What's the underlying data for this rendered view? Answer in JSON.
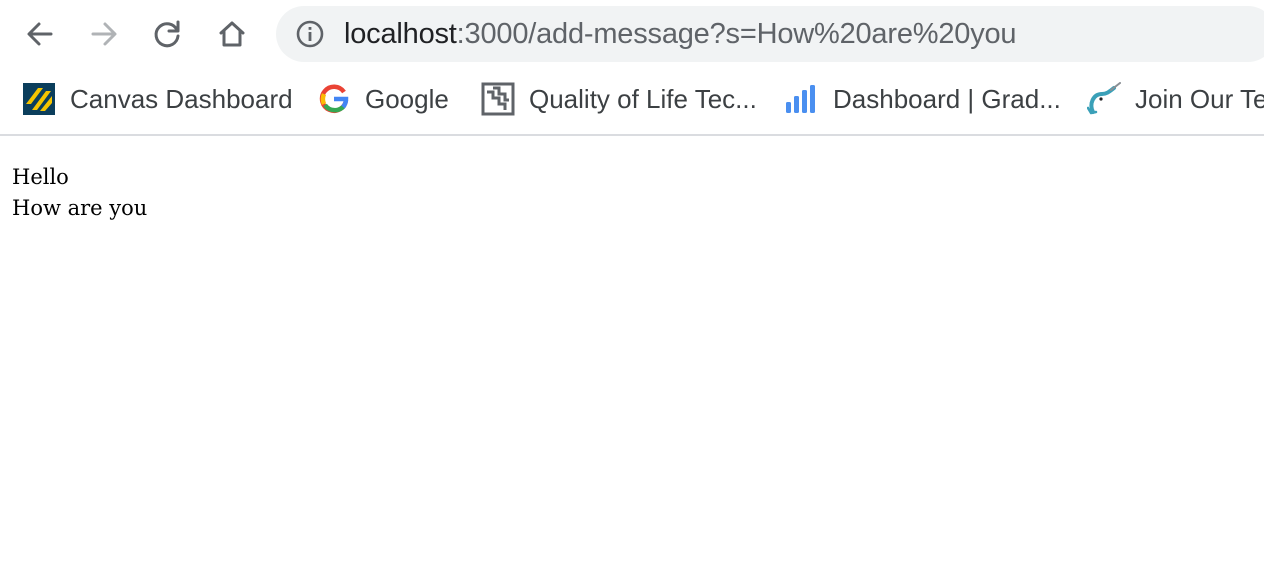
{
  "browser": {
    "nav": {
      "back": "arrow-left-icon",
      "forward": "arrow-right-icon",
      "reload": "reload-icon",
      "home": "home-icon"
    },
    "omnibox": {
      "host": "localhost",
      "rest": ":3000/add-message?s=How%20are%20you",
      "icon": "info-icon"
    },
    "bookmarks": [
      {
        "label": "Canvas Dashboard",
        "icon": "canvas-icon"
      },
      {
        "label": "Google",
        "icon": "google-icon"
      },
      {
        "label": "Quality of Life Tec...",
        "icon": "quality-of-life-icon"
      },
      {
        "label": "Dashboard | Grad...",
        "icon": "bar-chart-icon"
      },
      {
        "label": "Join Our Te",
        "icon": "narwhal-icon"
      }
    ]
  },
  "page": {
    "lines": [
      "Hello",
      "How are you"
    ]
  },
  "colors": {
    "omnibox_bg": "#f1f3f4",
    "icon_active": "#5f6368",
    "icon_disabled": "#b0b3b6",
    "bookmark_text": "#3c4043"
  }
}
